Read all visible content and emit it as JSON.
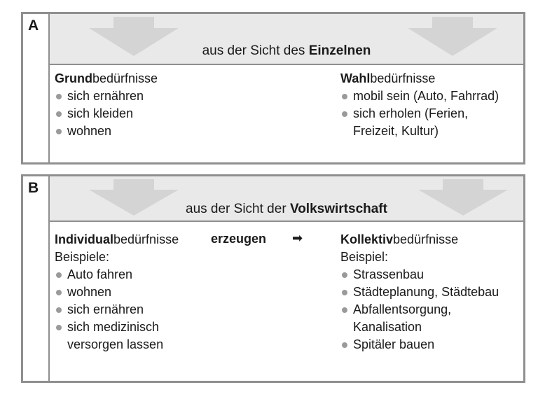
{
  "panel_a": {
    "letter": "A",
    "title_prefix": "aus der Sicht des ",
    "title_bold": "Einzelnen",
    "left": {
      "title_bold": "Grund",
      "title_rest": "bedürfnisse",
      "items": [
        "sich ernähren",
        "sich kleiden",
        "wohnen"
      ]
    },
    "right": {
      "title_bold": "Wahl",
      "title_rest": "bedürfnisse",
      "items": [
        "mobil sein (Auto, Fahrrad)",
        "sich erholen (Ferien,",
        "Freizeit, Kultur)"
      ]
    }
  },
  "panel_b": {
    "letter": "B",
    "title_prefix": "aus der Sicht der ",
    "title_bold": "Volkswirtschaft",
    "middle_label": "erzeugen",
    "middle_arrow": "➡",
    "left": {
      "title_bold": "Individual",
      "title_rest": "bedürfnisse",
      "subtitle": "Beispiele:",
      "items": [
        "Auto fahren",
        "wohnen",
        "sich ernähren",
        "sich medizinisch",
        "versorgen lassen"
      ]
    },
    "right": {
      "title_bold": "Kollektiv",
      "title_rest": "bedürfnisse",
      "subtitle": "Beispiel:",
      "items": [
        "Strassenbau",
        "Städteplanung, Städtebau",
        "Abfallentsorgung,",
        "Kanalisation",
        "Spitäler bauen"
      ]
    }
  },
  "colors": {
    "border": "#8f8f8f",
    "header_bg": "#e9e9e9",
    "arrow": "#d4d4d4",
    "bullet": "#9a9a9a"
  }
}
